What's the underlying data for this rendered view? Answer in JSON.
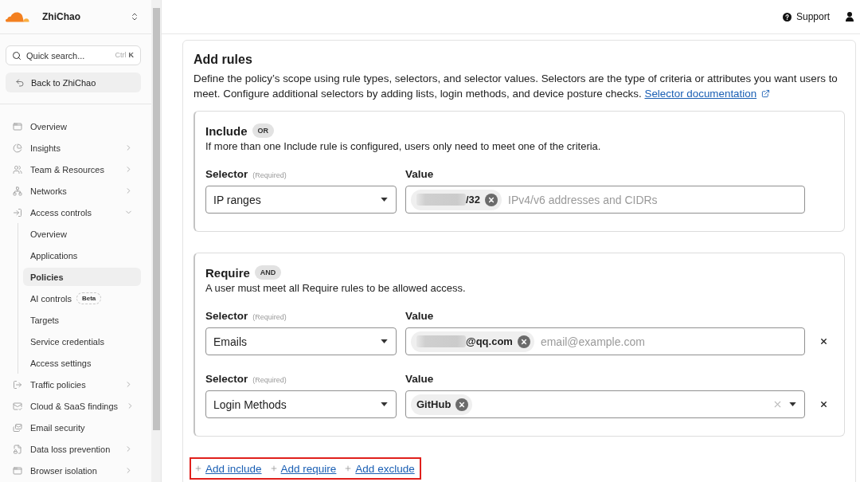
{
  "sidebar": {
    "org": "ZhiChao",
    "search": {
      "placeholder": "Quick search...",
      "shortcut": [
        "Ctrl",
        "K"
      ]
    },
    "back": "Back to ZhiChao",
    "items": [
      {
        "label": "Overview",
        "has_submenu": false,
        "expanded": false,
        "selected": false
      },
      {
        "label": "Insights",
        "has_submenu": true,
        "expanded": false,
        "selected": false
      },
      {
        "label": "Team & Resources",
        "has_submenu": true,
        "expanded": false,
        "selected": false
      },
      {
        "label": "Networks",
        "has_submenu": true,
        "expanded": false,
        "selected": false
      },
      {
        "label": "Access controls",
        "has_submenu": true,
        "expanded": true,
        "selected": false,
        "children": [
          {
            "label": "Overview",
            "selected": false
          },
          {
            "label": "Applications",
            "selected": false
          },
          {
            "label": "Policies",
            "selected": true
          },
          {
            "label": "AI controls",
            "badge": "Beta",
            "selected": false
          },
          {
            "label": "Targets",
            "selected": false
          },
          {
            "label": "Service credentials",
            "selected": false
          },
          {
            "label": "Access settings",
            "selected": false
          }
        ]
      },
      {
        "label": "Traffic policies",
        "has_submenu": true,
        "expanded": false,
        "selected": false
      },
      {
        "label": "Cloud & SaaS findings",
        "has_submenu": true,
        "expanded": false,
        "selected": false
      },
      {
        "label": "Email security",
        "has_submenu": false,
        "expanded": false,
        "selected": false
      },
      {
        "label": "Data loss prevention",
        "has_submenu": true,
        "expanded": false,
        "selected": false
      },
      {
        "label": "Browser isolation",
        "has_submenu": true,
        "expanded": false,
        "selected": false
      }
    ]
  },
  "header": {
    "support": "Support"
  },
  "rules": {
    "title": "Add rules",
    "description": "Define the policy’s scope using rule types, selectors, and selector values. Selectors are the type of criteria or attributes you want users to meet. Configure additional selectors by adding lists, login methods, and device posture checks.",
    "link": "Selector documentation",
    "groups": [
      {
        "title": "Include",
        "badge": "OR",
        "description": "If more than one Include rule is configured, users only need to meet one of the criteria.",
        "rows": [
          {
            "kind": "tags",
            "selector_label": "Selector",
            "required_note": "(Required)",
            "selector": "IP ranges",
            "value_label": "Value",
            "tags": [
              {
                "text": "/32",
                "redacted": true
              }
            ],
            "placeholder": "IPv4/v6 addresses and CIDRs",
            "removable": false
          }
        ]
      },
      {
        "title": "Require",
        "badge": "AND",
        "description": "A user must meet all Require rules to be allowed access.",
        "rows": [
          {
            "kind": "tags",
            "selector_label": "Selector",
            "required_note": "(Required)",
            "selector": "Emails",
            "value_label": "Value",
            "tags": [
              {
                "text": "@qq.com",
                "redacted": true
              }
            ],
            "placeholder": "email@example.com",
            "removable": true
          },
          {
            "kind": "select",
            "selector_label": "Selector",
            "required_note": "(Required)",
            "selector": "Login Methods",
            "value_label": "Value",
            "tags": [
              {
                "text": "GitHub",
                "redacted": false
              }
            ],
            "removable": true
          }
        ]
      }
    ],
    "actions": [
      {
        "label": "Add include"
      },
      {
        "label": "Add require"
      },
      {
        "label": "Add exclude"
      }
    ],
    "actions_highlighted": true
  }
}
